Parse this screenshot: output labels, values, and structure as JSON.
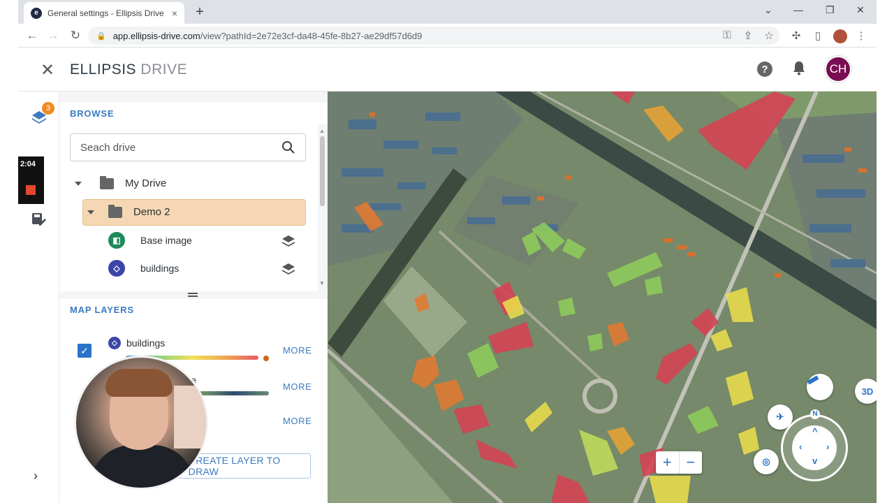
{
  "browser": {
    "tab_title": "General settings - Ellipsis Drive",
    "tab_close": "×",
    "new_tab": "+",
    "url_host": "app.ellipsis-drive.com",
    "url_path": "/view?pathId=2e72e3cf-da48-45fe-8b27-ae29df57d6d9",
    "back": "←",
    "forward": "→",
    "reload": "↻",
    "minimize": "—",
    "maximize": "❐",
    "close": "✕",
    "dropdown": "⌄"
  },
  "app": {
    "close": "✕",
    "logo_main": "ELLIPSIS",
    "logo_sub": " DRIVE",
    "help": "?",
    "bell": "🔔",
    "user_initials": "CH"
  },
  "rail": {
    "badge_count": "3",
    "recording_time": "2:04",
    "expand": "›"
  },
  "browse": {
    "title": "BROWSE",
    "search_placeholder": "Seach drive",
    "tree": [
      {
        "label": "My Drive"
      },
      {
        "label": "Demo 2"
      },
      {
        "label": "Base image",
        "icon_color": "#1e8a5a"
      },
      {
        "label": "buildings",
        "icon_color": "#3b45a8"
      }
    ]
  },
  "map_layers": {
    "title": "MAP LAYERS",
    "layers": [
      {
        "label": "buildings",
        "more": "MORE",
        "checked": true
      },
      {
        "label": "image",
        "more": "MORE"
      },
      {
        "label": "o",
        "more": "MORE"
      }
    ],
    "create_button": "CREATE LAYER TO DRAW"
  },
  "map": {
    "zoom_in": "+",
    "zoom_out": "−",
    "three_d": "3D",
    "north": "N"
  },
  "colors": {
    "accent": "#3b7bbf",
    "selected_folder": "#f5d8b3",
    "avatar": "#7a0d52",
    "badge": "#f08a24"
  }
}
